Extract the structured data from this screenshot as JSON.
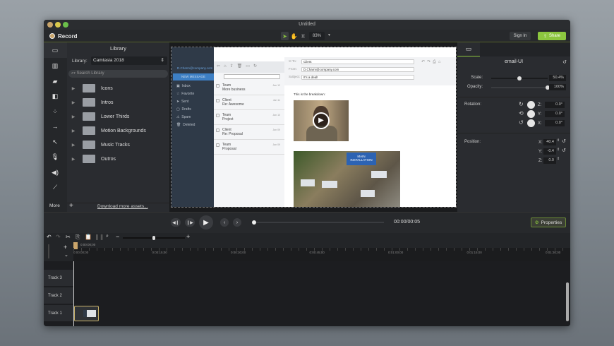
{
  "window": {
    "title": "Untitled"
  },
  "toolbar": {
    "record_label": "Record",
    "zoom": "83%",
    "sign_in": "Sign In",
    "share": "Share"
  },
  "sidebar": {
    "items": [
      "media-bin",
      "library",
      "annotations",
      "transitions",
      "behaviors",
      "animations",
      "cursor-effects",
      "voice-narration",
      "audio-effects",
      "visual-effects"
    ],
    "more": "More"
  },
  "library": {
    "title": "Library",
    "library_label": "Library:",
    "library_value": "Camtasia 2018",
    "search_placeholder": "Search Library",
    "folders": [
      "Icons",
      "Intros",
      "Lower Thirds",
      "Motion Backgrounds",
      "Music Tracks",
      "Outros"
    ],
    "download": "Download more assets..."
  },
  "preview": {
    "account": "D.Charm@company.com",
    "new_message": "NEW MESSAGE",
    "nav": [
      "Inbox",
      "Favorite",
      "Sent",
      "Drafts",
      "Spam",
      "Deleted"
    ],
    "messages": [
      {
        "from": "Team",
        "subject": "More business",
        "date": "Jan 12"
      },
      {
        "from": "Client",
        "subject": "Re: Awesome",
        "date": "Jan 11"
      },
      {
        "from": "Team",
        "subject": "Project",
        "date": "Jan 10"
      },
      {
        "from": "Client",
        "subject": "Re: Proposal",
        "date": "Jan 09"
      },
      {
        "from": "Team",
        "subject": "Proposal",
        "date": "Jan 09"
      }
    ],
    "to_label": "To:",
    "to": "Client",
    "from_label": "From:",
    "from": "D.Charm@company.com",
    "subject_label": "Subject:",
    "subject": "It's a deal!",
    "body": "This is the breakdown:",
    "map_label": "MAIN INSTALLATION"
  },
  "properties": {
    "clip_name": "email-UI",
    "scale_label": "Scale:",
    "scale": "50.4%",
    "scale_value": 0.504,
    "opacity_label": "Opacity:",
    "opacity": "100%",
    "opacity_value": 1.0,
    "rotation_label": "Rotation:",
    "rotation": [
      {
        "axis": "Z:",
        "value": "0.0°"
      },
      {
        "axis": "Y:",
        "value": "0.0°"
      },
      {
        "axis": "X:",
        "value": "0.0°"
      }
    ],
    "position_label": "Position:",
    "position": [
      {
        "axis": "X:",
        "value": "40.4"
      },
      {
        "axis": "Y:",
        "value": "-0.4"
      },
      {
        "axis": "Z:",
        "value": "0.0"
      }
    ],
    "button": "Properties"
  },
  "playback": {
    "time": "00:00/00:05",
    "progress": 0.0
  },
  "timeline": {
    "playhead": "0:00:00;00",
    "ticks": [
      "0:00:00;00",
      "0:00:15;00",
      "0:00:30;00",
      "0:00:45;00",
      "0:01:00;00",
      "0:01:15;00",
      "0:01:30;00"
    ],
    "tracks": [
      "Track 3",
      "Track 2",
      "Track 1"
    ],
    "zoom_value": 0.32
  },
  "colors": {
    "accent": "#8cc63f",
    "record": "#c9a46a"
  }
}
